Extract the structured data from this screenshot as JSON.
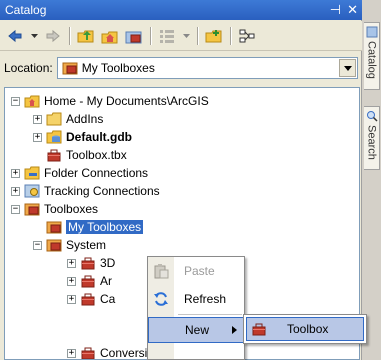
{
  "window": {
    "title": "Catalog",
    "pin_glyph": "⊣",
    "close_glyph": "✕"
  },
  "toolbar": {
    "icons": [
      "back-arrow-icon",
      "forward-arrow-icon",
      "up-folder-icon",
      "home-folder-icon",
      "toolboxes-icon",
      "view-grid-icon",
      "connect-folder-icon",
      "model-icon"
    ]
  },
  "location": {
    "label": "Location:",
    "value": "My Toolboxes"
  },
  "tree": {
    "items": [
      {
        "label": "Home - My Documents\\ArcGIS",
        "expander": "−",
        "icon": "home-folder-icon",
        "bold": false,
        "selected": false
      },
      {
        "label": "AddIns",
        "expander": "+",
        "icon": "folder-icon",
        "bold": false,
        "selected": false
      },
      {
        "label": "Default.gdb",
        "expander": "+",
        "icon": "geodatabase-icon",
        "bold": true,
        "selected": false
      },
      {
        "label": "Toolbox.tbx",
        "expander": "",
        "icon": "toolbox-icon",
        "bold": false,
        "selected": false
      },
      {
        "label": "Folder Connections",
        "expander": "+",
        "icon": "folder-connection-icon",
        "bold": false,
        "selected": false
      },
      {
        "label": "Tracking Connections",
        "expander": "+",
        "icon": "tracking-connection-icon",
        "bold": false,
        "selected": false
      },
      {
        "label": "Toolboxes",
        "expander": "−",
        "icon": "toolboxes-icon",
        "bold": false,
        "selected": false
      },
      {
        "label": "My Toolboxes",
        "expander": "",
        "icon": "toolboxes-icon",
        "bold": false,
        "selected": true
      },
      {
        "label": "System",
        "expander": "−",
        "icon": "toolboxes-icon",
        "bold": false,
        "selected": false
      },
      {
        "label": "3D",
        "expander": "+",
        "icon": "toolbox-icon",
        "bold": false,
        "selected": false
      },
      {
        "label": "Ar",
        "expander": "+",
        "icon": "toolbox-icon",
        "bold": false,
        "selected": false
      },
      {
        "label": "Ca",
        "expander": "+",
        "icon": "toolbox-icon",
        "bold": false,
        "selected": false
      },
      {
        "label": "Conversion Tools.tbx",
        "expander": "+",
        "icon": "toolbox-icon",
        "bold": false,
        "selected": false
      }
    ]
  },
  "context_menu": {
    "paste": "Paste",
    "refresh": "Refresh",
    "new": "New"
  },
  "submenu": {
    "toolbox": "Toolbox"
  },
  "side_tabs": {
    "catalog": "Catalog",
    "search": "Search"
  },
  "colors": {
    "selection": "#316ac5",
    "title_bar": "#2a5fbf",
    "menu_highlight": "#b8c7e6",
    "toolbox_red": "#c0392b"
  }
}
